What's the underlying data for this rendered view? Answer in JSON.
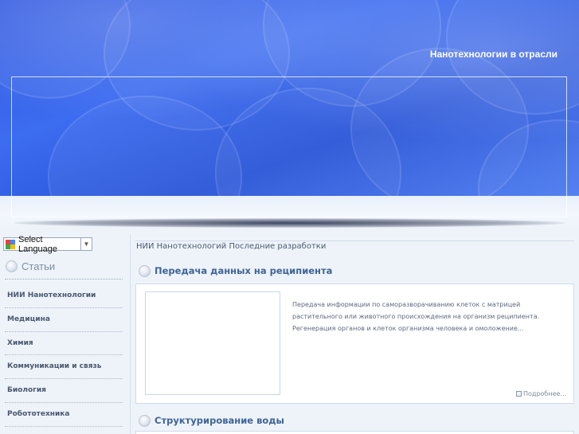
{
  "header": {
    "tagline": "Нанотехнологии в отрасли"
  },
  "language": {
    "label": "Select Language",
    "arrow": "▼"
  },
  "sidebar": {
    "title": "Статьи",
    "items": [
      {
        "label": "НИИ Нанотехнологии"
      },
      {
        "label": "Медицина"
      },
      {
        "label": "Химия"
      },
      {
        "label": "Коммуникации и связь"
      },
      {
        "label": "Биология"
      },
      {
        "label": "Робототехника"
      }
    ]
  },
  "main": {
    "breadcrumb": "НИИ Нанотехнологий Последние разработки",
    "articles": [
      {
        "title": "Передача данных на реципиента",
        "text_lines": [
          "Передача информации по саморазворачиванию клеток с матрицей",
          "растительного или животного происхождения на организм реципиента.",
          "Регенерация органов и клеток организма человека и омоложение..."
        ],
        "read_more": "Подробнее..."
      },
      {
        "title": "Структурирование воды"
      }
    ]
  },
  "colors": {
    "header_blue": "#3c6cf0",
    "heading": "#3e6496",
    "menu_text": "#4a5870"
  }
}
